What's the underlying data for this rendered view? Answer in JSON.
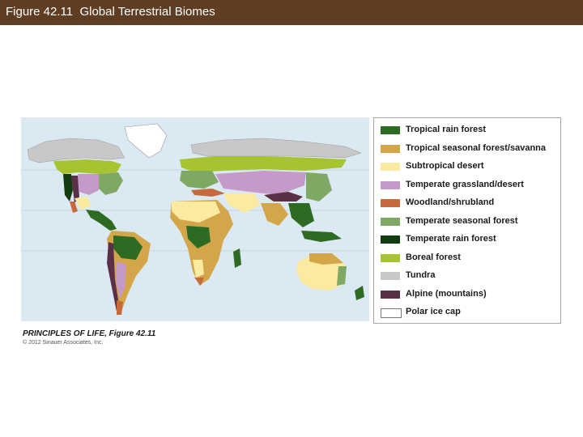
{
  "slide": {
    "title": "Figure 42.11  Global Terrestrial Biomes",
    "credit": "PRINCIPLES OF LIFE, Figure 42.11",
    "copyright": "© 2012 Sinauer Associates, Inc."
  },
  "colors": {
    "title_bar": "#5e3d22",
    "ocean": "#dbe9f2"
  },
  "legend": {
    "items": [
      {
        "label": "Tropical rain forest",
        "color": "#2e6b22"
      },
      {
        "label": "Tropical seasonal forest/savanna",
        "color": "#d4a64a"
      },
      {
        "label": "Subtropical desert",
        "color": "#faeba0"
      },
      {
        "label": "Temperate grassland/desert",
        "color": "#c59ac9"
      },
      {
        "label": "Woodland/shrubland",
        "color": "#c66a3c"
      },
      {
        "label": "Temperate seasonal forest",
        "color": "#7fa864"
      },
      {
        "label": "Temperate rain forest",
        "color": "#123b12"
      },
      {
        "label": "Boreal forest",
        "color": "#a6c430"
      },
      {
        "label": "Tundra",
        "color": "#c8c8c8"
      },
      {
        "label": "Alpine (mountains)",
        "color": "#5b3046"
      },
      {
        "label": "Polar ice cap",
        "color": "#ffffff"
      }
    ]
  }
}
